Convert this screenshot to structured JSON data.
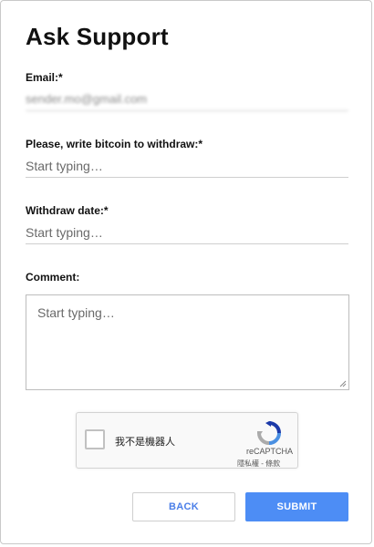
{
  "form": {
    "title": "Ask Support",
    "email": {
      "label": "Email:*",
      "value": "sender.mo@gmail.com"
    },
    "bitcoin": {
      "label": "Please, write bitcoin to withdraw:*",
      "placeholder": "Start typing…"
    },
    "withdraw_date": {
      "label": "Withdraw date:*",
      "placeholder": "Start typing…"
    },
    "comment": {
      "label": "Comment:",
      "placeholder": "Start typing…"
    }
  },
  "recaptcha": {
    "checkbox_label": "我不是機器人",
    "brand": "reCAPTCHA",
    "links": "隱私權 - 條款",
    "checked": false
  },
  "buttons": {
    "back": "BACK",
    "submit": "SUBMIT"
  },
  "colors": {
    "accent": "#4d8df5",
    "back_text": "#4a7ee8"
  }
}
